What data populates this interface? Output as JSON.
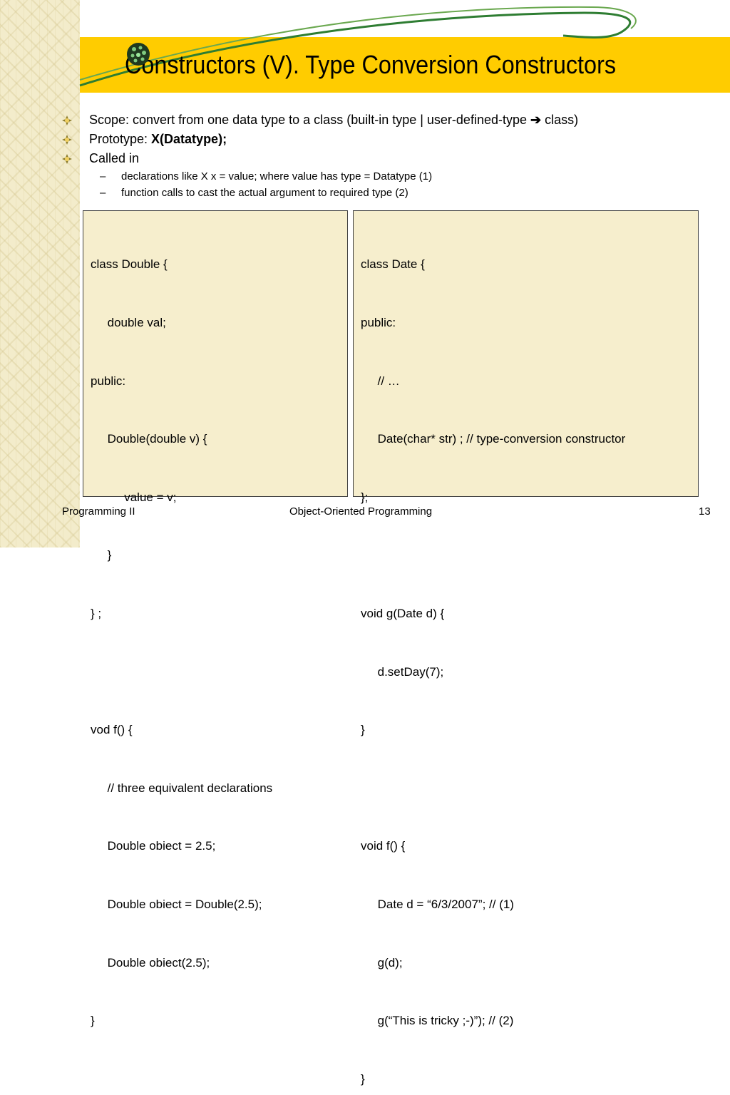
{
  "slide": {
    "title": "Constructors (V). Type Conversion Constructors"
  },
  "bullets": {
    "scope": {
      "text": "Scope: convert from one data type to a class (built-in type | user-defined-type ",
      "arrow": "➔",
      "after": " class)"
    },
    "prototype": {
      "label": "Prototype: ",
      "value": "X(Datatype);"
    },
    "called_in": {
      "label": "Called in",
      "subs": [
        "declarations like X x = value; where value has type = Datatype (1)",
        "function calls to cast the actual argument to required type (2)"
      ]
    },
    "dash": "–"
  },
  "code_left": [
    "class Double {",
    "     double val;",
    "public:",
    "     Double(double v) {",
    "          value = v;",
    "     }",
    "} ;",
    "",
    "vod f() {",
    "     // three equivalent declarations",
    "     Double obiect = 2.5;",
    "     Double obiect = Double(2.5);",
    "     Double obiect(2.5);",
    "}"
  ],
  "code_right": [
    "class Date {",
    "public:",
    "     // …",
    "     Date(char* str) ; // type-conversion constructor",
    "};",
    "",
    "void g(Date d) {",
    "     d.setDay(7);",
    "}",
    "",
    "void f() {",
    "     Date d = “6/3/2007”; // (1)",
    "     g(d);",
    "     g(“This is tricky ;-)”); // (2)",
    "}"
  ],
  "footer": {
    "left": "Programming II",
    "center": "Object-Oriented Programming",
    "page_number": "13"
  },
  "colors": {
    "title_bar": "#ffcc00",
    "code_bg": "#f6eecd",
    "swoosh": "#2e7d32",
    "texture": "#f3eccb"
  },
  "icons": {
    "title": "globe-icon",
    "bullet": "bullet-star-icon"
  }
}
